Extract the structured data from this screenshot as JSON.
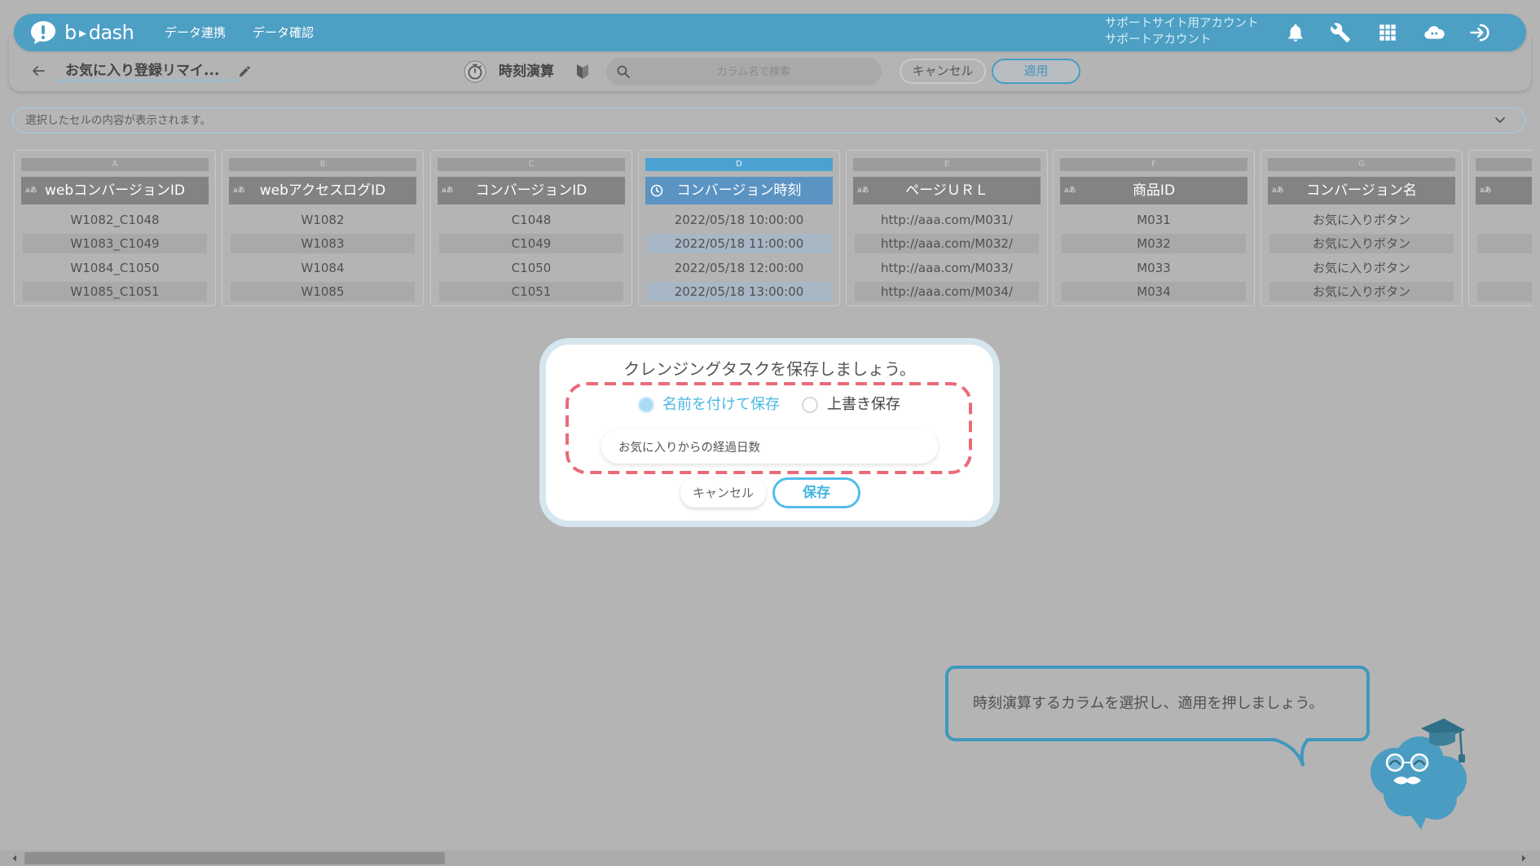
{
  "logo": {
    "left": "b",
    "right": "dash",
    "icon": "bdash-logo-icon"
  },
  "nav": {
    "links": [
      {
        "label": "データ連携"
      },
      {
        "label": "データ確認"
      }
    ],
    "account": {
      "line1": "サポートサイト用アカウント",
      "line2": "サポートアカウント"
    },
    "icons": [
      "bell-icon",
      "wrench-icon",
      "apps-grid-icon",
      "assistant-icon",
      "login-icon"
    ]
  },
  "toolbar": {
    "title": "お気に入り登録リマイ...",
    "mode_icon": "stopwatch-icon",
    "mode_label": "時刻演算",
    "search_placeholder": "カラム名で検索",
    "cancel_label": "キャンセル",
    "apply_label": "適用"
  },
  "cell_bar": {
    "placeholder": "選択したセルの内容が表示されます。"
  },
  "columns": [
    {
      "letter": "A",
      "name": "webコンバージョンID",
      "type_glyph": "aあ",
      "cells": [
        "W1082_C1048",
        "W1083_C1049",
        "W1084_C1050",
        "W1085_C1051"
      ]
    },
    {
      "letter": "B",
      "name": "webアクセスログID",
      "type_glyph": "aあ",
      "cells": [
        "W1082",
        "W1083",
        "W1084",
        "W1085"
      ]
    },
    {
      "letter": "C",
      "name": "コンバージョンID",
      "type_glyph": "aあ",
      "cells": [
        "C1048",
        "C1049",
        "C1050",
        "C1051"
      ]
    },
    {
      "letter": "D",
      "name": "コンバージョン時刻",
      "type_icon": "clock-icon",
      "selected": true,
      "cells": [
        "2022/05/18 10:00:00",
        "2022/05/18 11:00:00",
        "2022/05/18 12:00:00",
        "2022/05/18 13:00:00"
      ]
    },
    {
      "letter": "E",
      "name": "ページＵＲＬ",
      "type_glyph": "aあ",
      "cells": [
        "http://aaa.com/M031/",
        "http://aaa.com/M032/",
        "http://aaa.com/M033/",
        "http://aaa.com/M034/"
      ]
    },
    {
      "letter": "F",
      "name": "商品ID",
      "type_glyph": "aあ",
      "cells": [
        "M031",
        "M032",
        "M033",
        "M034"
      ]
    },
    {
      "letter": "G",
      "name": "コンバージョン名",
      "type_glyph": "aあ",
      "cells": [
        "お気に入りボタン",
        "お気に入りボタン",
        "お気に入りボタン",
        "お気に入りボタン"
      ]
    },
    {
      "type_glyph": "aあ"
    }
  ],
  "modal": {
    "title": "クレンジングタスクを保存しましょう。",
    "options": [
      {
        "label": "名前を付けて保存",
        "selected": true
      },
      {
        "label": "上書き保存",
        "selected": false
      }
    ],
    "name_value": "お気に入りからの経過日数",
    "cancel_label": "キャンセル",
    "save_label": "保存"
  },
  "hint": {
    "text": "時刻演算するカラムを選択し、適用を押しましょう。"
  },
  "colors": {
    "brand": "#4d9fc4",
    "active_column": "#5b93c3",
    "radio_selected": "#4ab8e4",
    "save_button": "#52bde9",
    "highlight_dash": "#ea6b78",
    "hint_border": "#3f98bd"
  }
}
